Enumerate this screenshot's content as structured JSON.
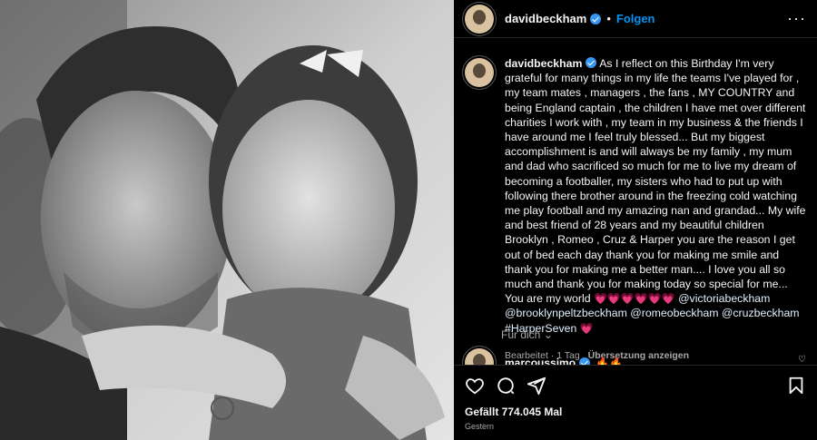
{
  "post": {
    "author": "davidbeckham",
    "follow_label": "Folgen",
    "dot": "•",
    "more_label": "···"
  },
  "caption": {
    "author": "davidbeckham",
    "text": "As I reflect on this Birthday I'm very grateful for many things in my life the teams I've played for , my team mates , managers , the fans , MY COUNTRY and being England captain , the children I have met over different charities I work with , my team in my business & the friends I have around me I feel truly blessed... But my biggest accomplishment is and will always be my family , my mum and dad who sacrificed so much for me to live my dream of becoming a footballer, my sisters who had to put up with following there brother around in the freezing cold watching me play football and my amazing nan and grandad... My wife and best friend of 28 years and my beautiful children Brooklyn , Romeo , Cruz & Harper you are the reason I get out of bed each day thank you for making me smile and thank you for making me a better man.... I love you all so much and thank you for making today so special for me... You are my world",
    "hearts": "💗💗💗💗💗💗",
    "mentions": [
      "@victoriabeckham",
      "@brooklynpeltzbeckham",
      "@romeobeckham",
      "@cruzbeckham",
      "#HarperSeven"
    ],
    "end_heart": "💗",
    "edited": "Bearbeitet · 1 Tag",
    "translate": "Übersetzung anzeigen"
  },
  "for_you": "Für dich",
  "comment": {
    "author": "marcoussimo",
    "text": "🔥🔥"
  },
  "actions": {
    "likes": "Gefällt 774.045 Mal",
    "date": "Gestern",
    "icons": [
      "heart-icon",
      "comment-icon",
      "share-icon",
      "bookmark-icon"
    ]
  },
  "colors": {
    "accent": "#0095f6",
    "verified": "#3897f0",
    "background": "#000000",
    "muted": "#a8a8a8"
  }
}
